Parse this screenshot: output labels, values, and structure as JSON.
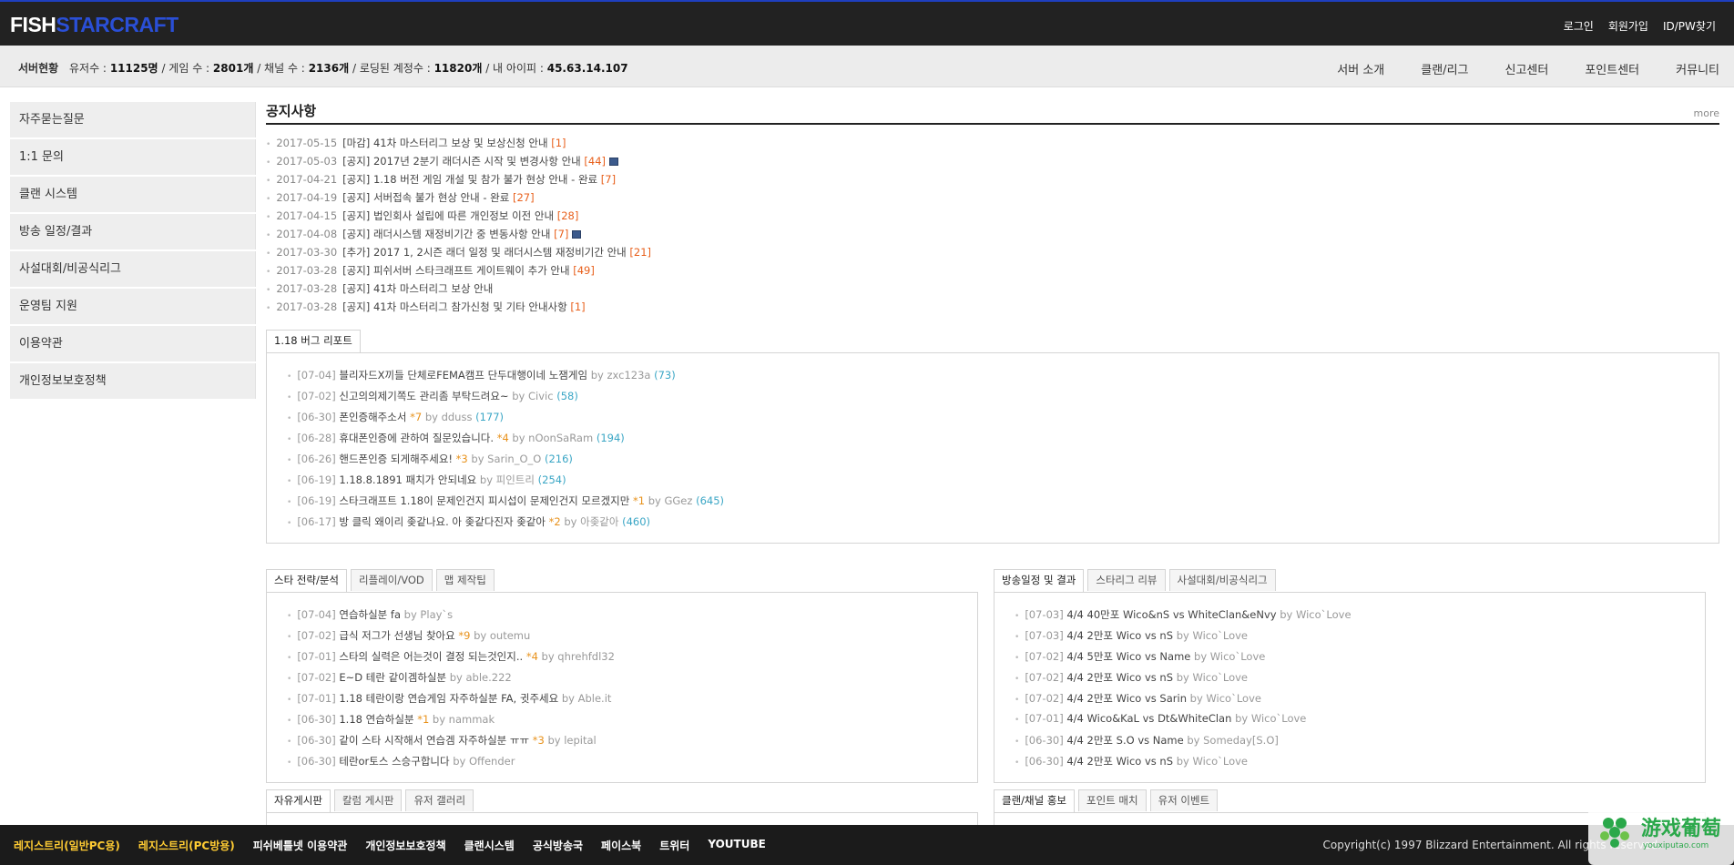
{
  "header": {
    "logo_part1": "FISH",
    "logo_part2": "STARCRAFT",
    "links": [
      "로그인",
      "회원가입",
      "ID/PW찾기"
    ]
  },
  "status": {
    "title": "서버현황",
    "users_label": "유저수 :",
    "users_value": "11125명",
    "games_label": "/ 게임 수 :",
    "games_value": "2801개",
    "channels_label": "/ 채널 수 :",
    "channels_value": "2136개",
    "loading_label": "/ 로딩된 계정수 :",
    "loading_value": "11820개",
    "ip_label": "/ 내 아이피 :",
    "ip_value": "45.63.14.107"
  },
  "main_menu": [
    "서버 소개",
    "클랜/리그",
    "신고센터",
    "포인트센터",
    "커뮤니티"
  ],
  "sidebar": [
    "자주묻는질문",
    "1:1 문의",
    "클랜 시스템",
    "방송 일정/결과",
    "사설대회/비공식리그",
    "운영팀 지원",
    "이용약관",
    "개인정보보호정책"
  ],
  "notice": {
    "title": "공지사항",
    "more": "more",
    "items": [
      {
        "date": "2017-05-15",
        "title": "[마감] 41차 마스터리그 보상 및 보상신청 안내",
        "count": "[1]",
        "save": false
      },
      {
        "date": "2017-05-03",
        "title": "[공지] 2017년 2분기 래더시즌 시작 및 변경사항 안내",
        "count": "[44]",
        "save": true
      },
      {
        "date": "2017-04-21",
        "title": "[공지] 1.18 버전 게임 개설 및 참가 불가 현상 안내 - 완료",
        "count": "[7]",
        "save": false
      },
      {
        "date": "2017-04-19",
        "title": "[공지] 서버접속 불가 현상 안내 - 완료",
        "count": "[27]",
        "save": false
      },
      {
        "date": "2017-04-15",
        "title": "[공지] 법인회사 설립에 따른 개인정보 이전 안내",
        "count": "[28]",
        "save": false
      },
      {
        "date": "2017-04-08",
        "title": "[공지] 래더시스템 재정비기간 중 변동사항 안내",
        "count": "[7]",
        "save": true
      },
      {
        "date": "2017-03-30",
        "title": "[추가] 2017 1, 2시즌 래더 일정 및 래더시스템 재정비기간 안내",
        "count": "[21]",
        "save": false
      },
      {
        "date": "2017-03-28",
        "title": "[공지] 피쉬서버 스타크래프트 게이트웨이 추가 안내",
        "count": "[49]",
        "save": false
      },
      {
        "date": "2017-03-28",
        "title": "[공지] 41차 마스터리그 보상 안내",
        "count": "",
        "save": false
      },
      {
        "date": "2017-03-28",
        "title": "[공지] 41차 마스터리그 참가신청 및 기타 안내사항",
        "count": "[1]",
        "save": false
      }
    ]
  },
  "bug": {
    "tab": "1.18 버그 리포트",
    "items": [
      {
        "date": "[07-04]",
        "title": "블리자드X끼들 단체로FEMA캠프 단두대행이네 노잼게임",
        "star": "",
        "by": "by zxc123a",
        "num": "(73)"
      },
      {
        "date": "[07-02]",
        "title": "신고의의제기쪽도 관리좀 부탁드려요~",
        "star": "",
        "by": "by Civic",
        "num": "(58)"
      },
      {
        "date": "[06-30]",
        "title": "폰인증해주소서",
        "star": "*7",
        "by": "by dduss",
        "num": "(177)"
      },
      {
        "date": "[06-28]",
        "title": "휴대폰인증에 관하여 질문있습니다.",
        "star": "*4",
        "by": "by nOonSaRam",
        "num": "(194)"
      },
      {
        "date": "[06-26]",
        "title": "핸드폰인증 되게해주세요!",
        "star": "*3",
        "by": "by Sarin_O_O",
        "num": "(216)"
      },
      {
        "date": "[06-19]",
        "title": "1.18.8.1891 패치가 안되네요",
        "star": "",
        "by": "by 피인트리",
        "num": "(254)"
      },
      {
        "date": "[06-19]",
        "title": "스타크래프트 1.18이 문제인건지 피시섭이 문제인건지 모르겠지만",
        "star": "*1",
        "by": "by GGez",
        "num": "(645)"
      },
      {
        "date": "[06-17]",
        "title": "방 클릭 왜이리 좆같나요. 아 좆같다진자 좆같아",
        "star": "*2",
        "by": "by 아좆같아",
        "num": "(460)"
      }
    ]
  },
  "strategy": {
    "tabs": [
      "스타 전략/분석",
      "리플레이/VOD",
      "맵 제작팁"
    ],
    "items": [
      {
        "date": "[07-04]",
        "title": "연습하실분 fa",
        "star": "",
        "by": "by Play`s"
      },
      {
        "date": "[07-02]",
        "title": "급식 저그가 선생님 찾아요",
        "star": "*9",
        "by": "by outemu"
      },
      {
        "date": "[07-01]",
        "title": "스타의 실력은 어는것이 결정 되는것인지..",
        "star": "*4",
        "by": "by qhrehfdl32"
      },
      {
        "date": "[07-02]",
        "title": "E~D 테란 같이겜하실분",
        "star": "",
        "by": "by able.222"
      },
      {
        "date": "[07-01]",
        "title": "1.18 테란이랑 연습게임 자주하실분 FA, 귓주세요",
        "star": "",
        "by": "by Able.it"
      },
      {
        "date": "[06-30]",
        "title": "1.18 연습하실분",
        "star": "*1",
        "by": "by nammak"
      },
      {
        "date": "[06-30]",
        "title": "같이 스타 시작해서 연습겜 자주하실분 ㅠㅠ",
        "star": "*3",
        "by": "by lepital"
      },
      {
        "date": "[06-30]",
        "title": "테란or토스 스승구합니다",
        "star": "",
        "by": "by Offender"
      }
    ]
  },
  "broadcast": {
    "tabs": [
      "방송일정 및 결과",
      "스타리그 리뷰",
      "사설대회/비공식리그"
    ],
    "items": [
      {
        "date": "[07-03]",
        "title": "4/4 40만포 Wico&nS vs WhiteClan&eNvy",
        "by": "by Wico`Love"
      },
      {
        "date": "[07-03]",
        "title": "4/4 2만포 Wico vs nS",
        "by": "by Wico`Love"
      },
      {
        "date": "[07-02]",
        "title": "4/4 5만포 Wico vs Name",
        "by": "by Wico`Love"
      },
      {
        "date": "[07-02]",
        "title": "4/4 2만포 Wico vs nS",
        "by": "by Wico`Love"
      },
      {
        "date": "[07-02]",
        "title": "4/4 2만포 Wico vs Sarin",
        "by": "by Wico`Love"
      },
      {
        "date": "[07-01]",
        "title": "4/4 Wico&KaL vs Dt&WhiteClan",
        "by": "by Wico`Love"
      },
      {
        "date": "[06-30]",
        "title": "4/4 2만포 S.O vs Name",
        "by": "by Someday[S.O]"
      },
      {
        "date": "[06-30]",
        "title": "4/4 2만포 Wico vs nS",
        "by": "by Wico`Love"
      }
    ]
  },
  "free_tabs": [
    "자유게시판",
    "칼럼 게시판",
    "유저 갤러리"
  ],
  "clan_tabs": [
    "클랜/채널 홍보",
    "포인트 매치",
    "유저 이벤트"
  ],
  "footer": {
    "links": [
      "레지스트리(일반PC용)",
      "레지스트리(PC방용)",
      "피쉬베틀넷 이용약관",
      "개인정보보호정책",
      "클랜시스템",
      "공식방송국",
      "페이스북",
      "트위터",
      "YOUTUBE"
    ],
    "copyright": "Copyright(c) 1997 Blizzard Entertainment. All rights reserved.",
    "watermark": "游戏葡萄",
    "watermark_url": "youxiputao.com"
  }
}
